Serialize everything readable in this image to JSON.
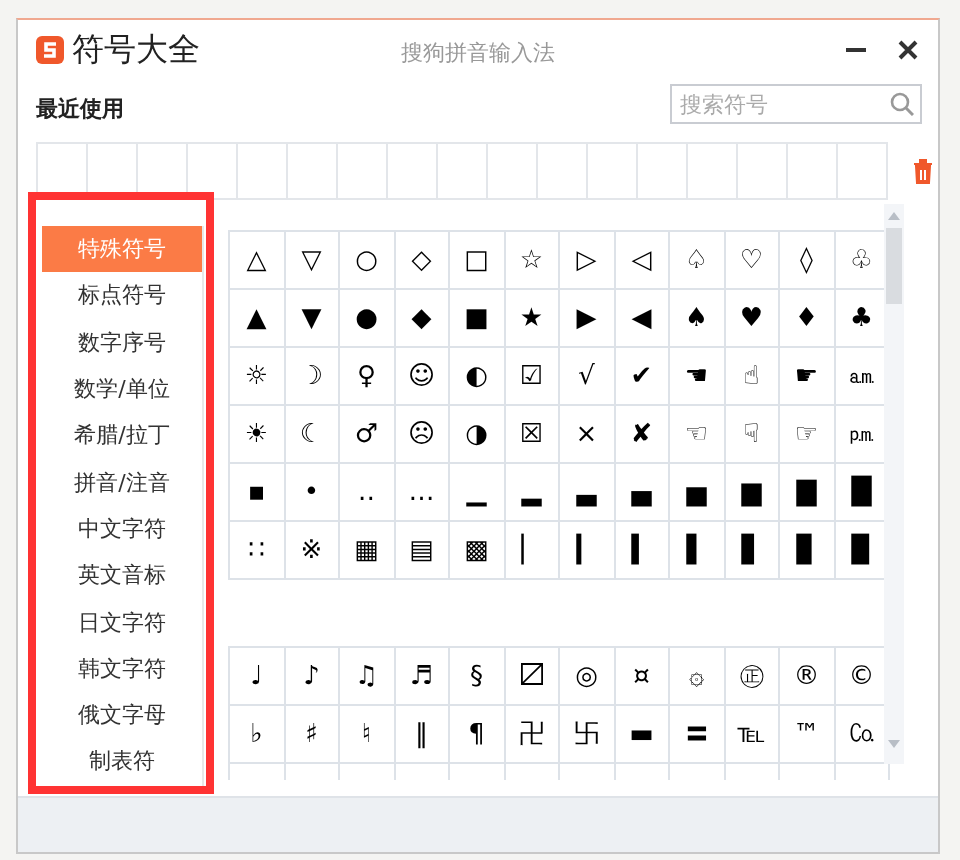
{
  "window": {
    "title": "符号大全",
    "app_name": "搜狗拼音输入法"
  },
  "recent": {
    "label": "最近使用"
  },
  "search": {
    "placeholder": "搜索符号"
  },
  "sidebar": {
    "items": [
      {
        "label": "特殊符号",
        "selected": true
      },
      {
        "label": "标点符号",
        "selected": false
      },
      {
        "label": "数字序号",
        "selected": false
      },
      {
        "label": "数学/单位",
        "selected": false
      },
      {
        "label": "希腊/拉丁",
        "selected": false
      },
      {
        "label": "拼音/注音",
        "selected": false
      },
      {
        "label": "中文字符",
        "selected": false
      },
      {
        "label": "英文音标",
        "selected": false
      },
      {
        "label": "日文字符",
        "selected": false
      },
      {
        "label": "韩文字符",
        "selected": false
      },
      {
        "label": "俄文字母",
        "selected": false
      },
      {
        "label": "制表符",
        "selected": false
      }
    ]
  },
  "symbol_grids": [
    {
      "rows": [
        [
          "△",
          "▽",
          "○",
          "◇",
          "□",
          "☆",
          "▷",
          "◁",
          "♤",
          "♡",
          "◊",
          "♧"
        ],
        [
          "▲",
          "▼",
          "●",
          "◆",
          "■",
          "★",
          "▶",
          "◀",
          "♠",
          "♥",
          "♦",
          "♣"
        ],
        [
          "☼",
          "☽",
          "♀",
          "☺",
          "◐",
          "☑",
          "√",
          "✔",
          "☚",
          "☝",
          "☛",
          "㏂"
        ],
        [
          "☀",
          "☾",
          "♂",
          "☹",
          "◑",
          "☒",
          "×",
          "✘",
          "☜",
          "☟",
          "☞",
          "㏘"
        ],
        [
          "▪",
          "•",
          "‥",
          "…",
          "▁",
          "▂",
          "▃",
          "▄",
          "▅",
          "▆",
          "▇",
          "█"
        ],
        [
          "∷",
          "※",
          "▦",
          "▤",
          "▩",
          "▏",
          "▎",
          "▍",
          "▌",
          "▋",
          "▊",
          "▉"
        ]
      ]
    },
    {
      "rows": [
        [
          "♩",
          "♪",
          "♫",
          "♬",
          "§",
          "〼",
          "◎",
          "¤",
          "۞",
          "㊣",
          "®",
          "©"
        ],
        [
          "♭",
          "♯",
          "♮",
          "‖",
          "¶",
          "卍",
          "卐",
          "▬",
          "〓",
          "℡",
          "™",
          "㏇"
        ]
      ]
    }
  ]
}
